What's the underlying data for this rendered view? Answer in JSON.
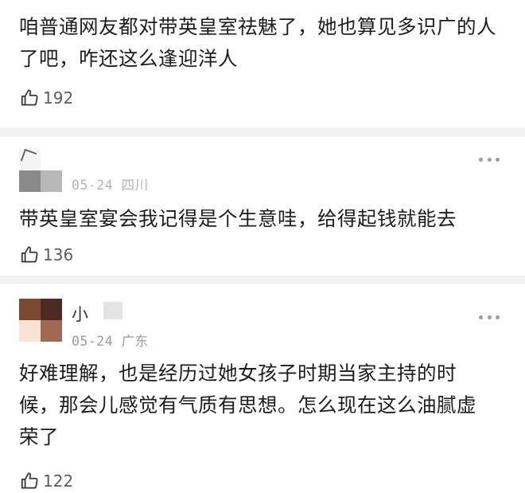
{
  "comments": [
    {
      "text": "咱普通网友都对带英皇室祛魅了，她也算见多识广的人了吧，咋还这么逢迎洋人",
      "likes": "192"
    },
    {
      "meta": "05-24 四川",
      "text": "带英皇室宴会我记得是个生意哇，给得起钱就能去",
      "likes": "136"
    },
    {
      "name": "小",
      "meta": "05-24 广东",
      "text": "好难理解，也是经历过她女孩子时期当家主持的时候，那会儿感觉有气质有思想。怎么现在这么油腻虚荣了",
      "likes": "122"
    }
  ],
  "icons": {
    "like": "thumbs-up-icon",
    "more": "more-dots-icon"
  },
  "colors": {
    "text": "#1c1c1c",
    "meta": "#9a9a9a",
    "divider": "#f2f2f2"
  }
}
